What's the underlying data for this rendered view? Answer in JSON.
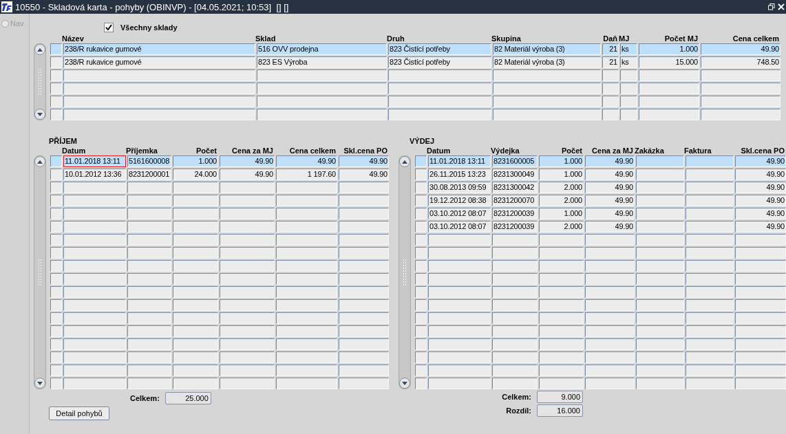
{
  "window": {
    "title": "10550 - Skladová karta - pohyby (OBINVP) - [04.05.2021; 10:53]  [] []"
  },
  "nav": {
    "label": "Nav",
    "selected": false
  },
  "all_warehouses": {
    "label": "Všechny sklady",
    "checked": true
  },
  "items_table": {
    "columns": [
      {
        "label": "Název",
        "kind": "text"
      },
      {
        "label": "Sklad",
        "kind": "text"
      },
      {
        "label": "Druh",
        "kind": "text"
      },
      {
        "label": "Skupina",
        "kind": "text"
      },
      {
        "label": "Daň",
        "kind": "number"
      },
      {
        "label": "MJ",
        "kind": "text"
      },
      {
        "label": "Počet MJ",
        "kind": "number"
      },
      {
        "label": "Cena celkem",
        "kind": "number"
      }
    ],
    "rows": [
      {
        "selected": true,
        "focused": false,
        "cells": [
          "238/R rukavice gumové",
          "516 OVV prodejna",
          "823 Čistící potřeby",
          "82 Materiál výroba (3)",
          "21",
          "ks",
          "1.000",
          "49.90"
        ]
      },
      {
        "selected": false,
        "focused": false,
        "cells": [
          "238/R rukavice gumové",
          "823 ES Výroba",
          "823 Čistící potřeby",
          "82 Materiál výroba (3)",
          "21",
          "ks",
          "15.000",
          "748.50"
        ]
      }
    ]
  },
  "receipts": {
    "title": "PŘÍJEM",
    "columns": [
      {
        "label": "Datum",
        "kind": "text"
      },
      {
        "label": "Příjemka",
        "kind": "text"
      },
      {
        "label": "Počet",
        "kind": "number"
      },
      {
        "label": "Cena za MJ",
        "kind": "number"
      },
      {
        "label": "Cena celkem",
        "kind": "number"
      },
      {
        "label": "Skl.cena PO",
        "kind": "number"
      }
    ],
    "rows": [
      {
        "selected": true,
        "focused": true,
        "cells": [
          "11.01.2018 13:11",
          "5161600008",
          "1.000",
          "49.90",
          "49.90",
          "49.90"
        ]
      },
      {
        "selected": false,
        "focused": false,
        "cells": [
          "10.01.2012 13:36",
          "8231200001",
          "24.000",
          "49.90",
          "1 197.60",
          "49.90"
        ]
      }
    ],
    "total_label": "Celkem:",
    "total": "25.000"
  },
  "issues": {
    "title": "VÝDEJ",
    "columns": [
      {
        "label": "Datum",
        "kind": "text"
      },
      {
        "label": "Výdejka",
        "kind": "text"
      },
      {
        "label": "Počet",
        "kind": "number"
      },
      {
        "label": "Cena za MJ",
        "kind": "number"
      },
      {
        "label": "Zakázka",
        "kind": "text"
      },
      {
        "label": "Faktura",
        "kind": "text"
      },
      {
        "label": "Skl.cena PO",
        "kind": "number"
      }
    ],
    "rows": [
      {
        "selected": true,
        "focused": false,
        "cells": [
          "11.01.2018 13:11",
          "8231600005",
          "1.000",
          "49.90",
          "",
          "",
          "49.90"
        ]
      },
      {
        "selected": false,
        "focused": false,
        "cells": [
          "26.11.2015 13:23",
          "8231300049",
          "1.000",
          "49.90",
          "",
          "",
          "49.90"
        ]
      },
      {
        "selected": false,
        "focused": false,
        "cells": [
          "30.08.2013 09:59",
          "8231300042",
          "2.000",
          "49.90",
          "",
          "",
          "49.90"
        ]
      },
      {
        "selected": false,
        "focused": false,
        "cells": [
          "19.12.2012 08:38",
          "8231200070",
          "2.000",
          "49.90",
          "",
          "",
          "49.90"
        ]
      },
      {
        "selected": false,
        "focused": false,
        "cells": [
          "03.10.2012 08:07",
          "8231200039",
          "1.000",
          "49.90",
          "",
          "",
          "49.90"
        ]
      },
      {
        "selected": false,
        "focused": false,
        "cells": [
          "03.10.2012 08:07",
          "8231200039",
          "2.000",
          "49.90",
          "",
          "",
          "49.90"
        ]
      }
    ],
    "total_label": "Celkem:",
    "total": "9.000",
    "difference_label": "Rozdíl:",
    "difference": "16.000"
  },
  "detail_button": "Detail pohybů"
}
